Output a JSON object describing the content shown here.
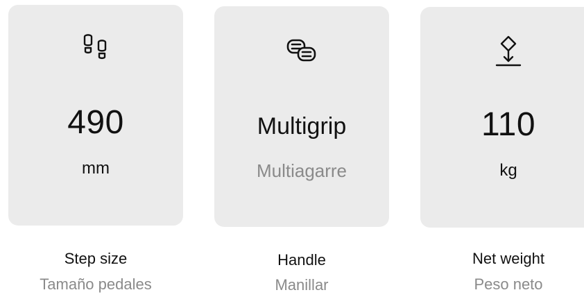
{
  "specs": [
    {
      "icon": "footprints-icon",
      "value": "490",
      "unit": "mm",
      "label": "Step size",
      "sublabel": "Tamaño pedales"
    },
    {
      "icon": "handle-grips-icon",
      "value": "Multigrip",
      "unit": "Multiagarre",
      "label": "Handle",
      "sublabel": "Manillar"
    },
    {
      "icon": "weight-scale-icon",
      "value": "110",
      "unit": "kg",
      "label": "Net weight",
      "sublabel": "Peso neto"
    }
  ],
  "colors": {
    "card_background": "#ebebeb",
    "text_primary": "#111111",
    "text_secondary": "#8a8a8a"
  }
}
